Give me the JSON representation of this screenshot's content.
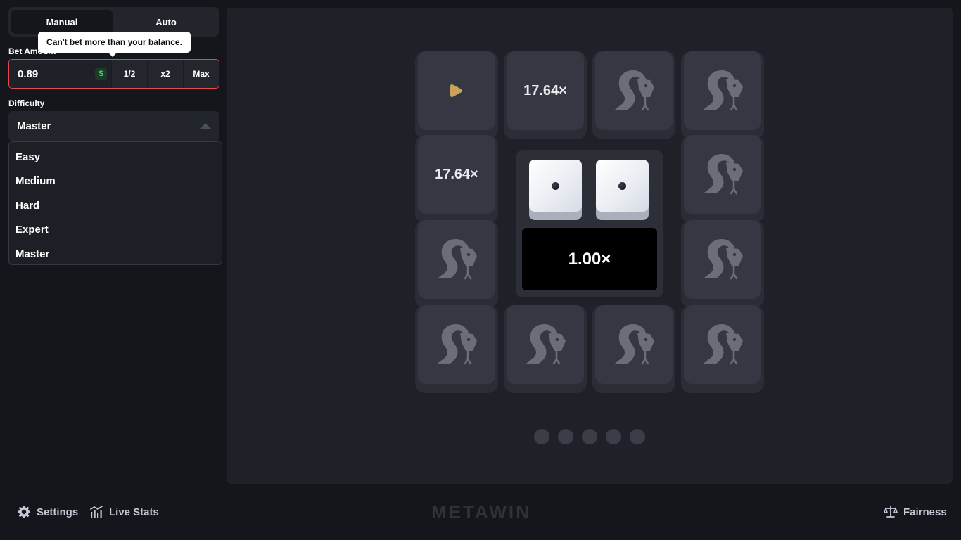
{
  "sidebar": {
    "tabs": [
      {
        "label": "Manual",
        "active": true
      },
      {
        "label": "Auto",
        "active": false
      }
    ],
    "bet": {
      "label": "Bet Amount",
      "value": "0.89",
      "currency_symbol": "$",
      "half_label": "1/2",
      "double_label": "x2",
      "max_label": "Max",
      "error_tooltip": "Can't bet more than your balance."
    },
    "difficulty": {
      "label": "Difficulty",
      "selected": "Master",
      "options": [
        "Easy",
        "Medium",
        "Hard",
        "Expert",
        "Master"
      ]
    }
  },
  "board": {
    "tiles": [
      {
        "type": "start",
        "icon": "play-icon"
      },
      {
        "type": "multiplier",
        "label": "17.64×"
      },
      {
        "type": "snake",
        "icon": "snake-icon"
      },
      {
        "type": "snake",
        "icon": "snake-icon"
      },
      {
        "type": "multiplier",
        "label": "17.64×"
      },
      {
        "type": "snake",
        "icon": "snake-icon"
      },
      {
        "type": "snake",
        "icon": "snake-icon"
      },
      {
        "type": "snake",
        "icon": "snake-icon"
      },
      {
        "type": "snake",
        "icon": "snake-icon"
      },
      {
        "type": "snake",
        "icon": "snake-icon"
      },
      {
        "type": "snake",
        "icon": "snake-icon"
      },
      {
        "type": "snake",
        "icon": "snake-icon"
      }
    ],
    "dice": [
      1,
      1
    ],
    "current_multiplier": "1.00×",
    "progress_steps": 5
  },
  "footer": {
    "settings_label": "Settings",
    "live_stats_label": "Live Stats",
    "brand": "METAWIN",
    "fairness_label": "Fairness"
  },
  "colors": {
    "background": "#14161b",
    "panel": "#1e2128",
    "tile": "#353742",
    "error_border": "#e5484d",
    "start_icon": "#c9a25a",
    "currency_green": "#3ddc6e"
  }
}
